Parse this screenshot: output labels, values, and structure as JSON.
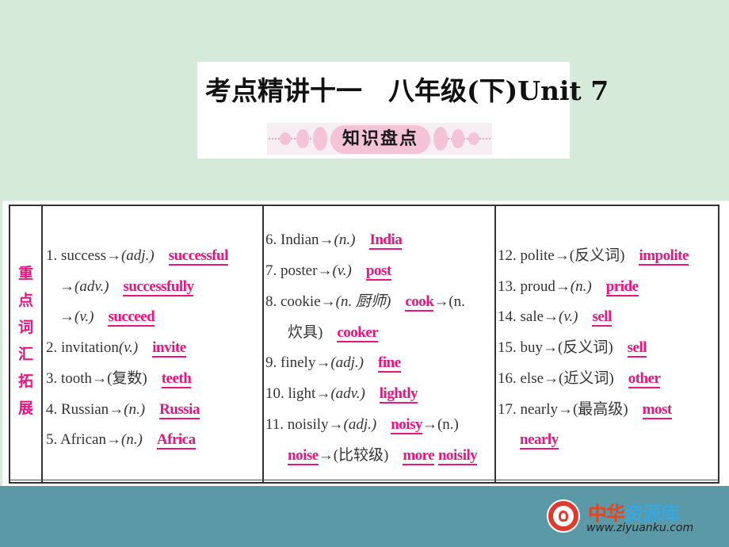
{
  "header": {
    "title": "考点精讲十一　八年级(下)Unit 7",
    "banner": "知识盘点"
  },
  "table": {
    "row_label": [
      "重",
      "点",
      "词",
      "汇",
      "拓",
      "展"
    ],
    "col1": [
      {
        "num": "1.",
        "word": "success",
        "arrow": "→",
        "pos": "(adj.)",
        "answer": "successful"
      },
      {
        "indent": true,
        "arrow": "→",
        "pos": "(adv.)",
        "answer": "successfully"
      },
      {
        "indent": true,
        "arrow": "→",
        "pos": "(v.)",
        "answer": "succeed"
      },
      {
        "num": "2.",
        "word": "invitation",
        "arrow": "",
        "pos": "(v.)",
        "answer": "invite"
      },
      {
        "num": "3.",
        "word": "tooth",
        "arrow": "→",
        "pos": "(复数)",
        "answer": "teeth"
      },
      {
        "num": "4.",
        "word": "Russian",
        "arrow": "→",
        "pos": "(n.)",
        "answer": "Russia"
      },
      {
        "num": "5.",
        "word": "African",
        "arrow": "→",
        "pos": "(n.)",
        "answer": "Africa"
      }
    ],
    "col2": [
      {
        "num": "6.",
        "word": "Indian",
        "arrow": "→",
        "pos": "(n.)",
        "answer": "India"
      },
      {
        "num": "7.",
        "word": "poster",
        "arrow": "→",
        "pos": "(v.)",
        "answer": "post"
      },
      {
        "num": "8.",
        "word": "cookie",
        "arrow": "→",
        "pos": "(n. 厨师)",
        "answer": "cook",
        "tail": "→(n."
      },
      {
        "indent": true,
        "pos": "炊具)",
        "answer": "cooker"
      },
      {
        "num": "9.",
        "word": "finely",
        "arrow": "→",
        "pos": "(adj.)",
        "answer": "fine"
      },
      {
        "num": "10.",
        "word": "light",
        "arrow": "→",
        "pos": "(adv.)",
        "answer": "lightly"
      },
      {
        "num": "11.",
        "word": "noisily",
        "arrow": "→",
        "pos": "(adj.)",
        "answer": "noisy",
        "tail": "→(n.)"
      },
      {
        "indent": true,
        "answer_first": "noise",
        "pos": "→(比较级)",
        "answer": "more",
        "answer2": "noisily"
      }
    ],
    "col3": [
      {
        "num": "12.",
        "word": "polite",
        "arrow": "→",
        "pos": "(反义词)",
        "answer": "impolite"
      },
      {
        "num": "13.",
        "word": "proud",
        "arrow": "→",
        "pos": "(n.)",
        "answer": "pride"
      },
      {
        "num": "14.",
        "word": "sale",
        "arrow": "→",
        "pos": "(v.)",
        "answer": "sell"
      },
      {
        "num": "15.",
        "word": "buy",
        "arrow": "→",
        "pos": "(反义词)",
        "answer": "sell"
      },
      {
        "num": "16.",
        "word": "else",
        "arrow": "→",
        "pos": "(近义词)",
        "answer": "other"
      },
      {
        "num": "17.",
        "word": "nearly",
        "arrow": "→",
        "pos": "(最高级)",
        "answer": "most"
      },
      {
        "indent": true,
        "answer": "nearly"
      }
    ]
  },
  "logo": {
    "name_part1": "中华",
    "name_part2": "资源库",
    "url": "www.ziyuanku.com"
  },
  "colors": {
    "answer": "#e8157e",
    "background": "#d6eada",
    "band": "#5a99a5"
  }
}
